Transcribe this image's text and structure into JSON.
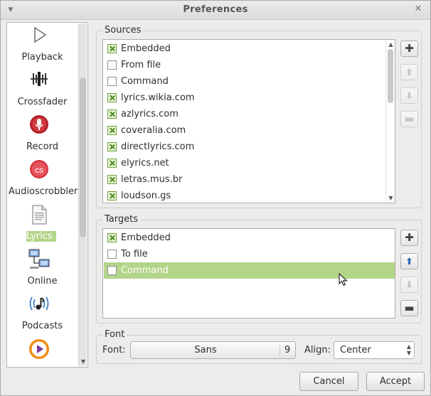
{
  "window": {
    "title": "Preferences"
  },
  "sidebar": {
    "items": [
      {
        "label": "Playback",
        "icon": "play-icon",
        "selected": false
      },
      {
        "label": "Crossfader",
        "icon": "crossfader-icon",
        "selected": false
      },
      {
        "label": "Record",
        "icon": "record-icon",
        "selected": false
      },
      {
        "label": "Audioscrobbler",
        "icon": "audioscrobbler-icon",
        "selected": false
      },
      {
        "label": "Lyrics",
        "icon": "document-icon",
        "selected": true
      },
      {
        "label": "Online",
        "icon": "network-icon",
        "selected": false
      },
      {
        "label": "Podcasts",
        "icon": "podcast-icon",
        "selected": false
      },
      {
        "label": "",
        "icon": "media-play-icon",
        "selected": false
      }
    ]
  },
  "sources": {
    "title": "Sources",
    "items": [
      {
        "label": "Embedded",
        "checked": true
      },
      {
        "label": "From file",
        "checked": false
      },
      {
        "label": "Command",
        "checked": false
      },
      {
        "label": "lyrics.wikia.com",
        "checked": true
      },
      {
        "label": "azlyrics.com",
        "checked": true
      },
      {
        "label": "coveralia.com",
        "checked": true
      },
      {
        "label": "directlyrics.com",
        "checked": true
      },
      {
        "label": "elyrics.net",
        "checked": true
      },
      {
        "label": "letras.mus.br",
        "checked": true
      },
      {
        "label": "loudson.gs",
        "checked": true
      }
    ],
    "buttons": [
      "add-icon",
      "move-up-icon",
      "move-down-icon",
      "remove-icon"
    ]
  },
  "targets": {
    "title": "Targets",
    "items": [
      {
        "label": "Embedded",
        "checked": true
      },
      {
        "label": "To file",
        "checked": false
      },
      {
        "label": "Command",
        "checked": false,
        "selected": true
      }
    ],
    "buttons": [
      "add-icon",
      "move-up-icon",
      "move-down-icon",
      "remove-icon"
    ]
  },
  "font": {
    "title": "Font",
    "font_label": "Font:",
    "font_name": "Sans",
    "font_size": "9",
    "align_label": "Align:",
    "align_value": "Center"
  },
  "footer": {
    "cancel": "Cancel",
    "accept": "Accept"
  },
  "colors": {
    "selection": "#b3d58a",
    "accent_blue": "#2f69b8"
  }
}
